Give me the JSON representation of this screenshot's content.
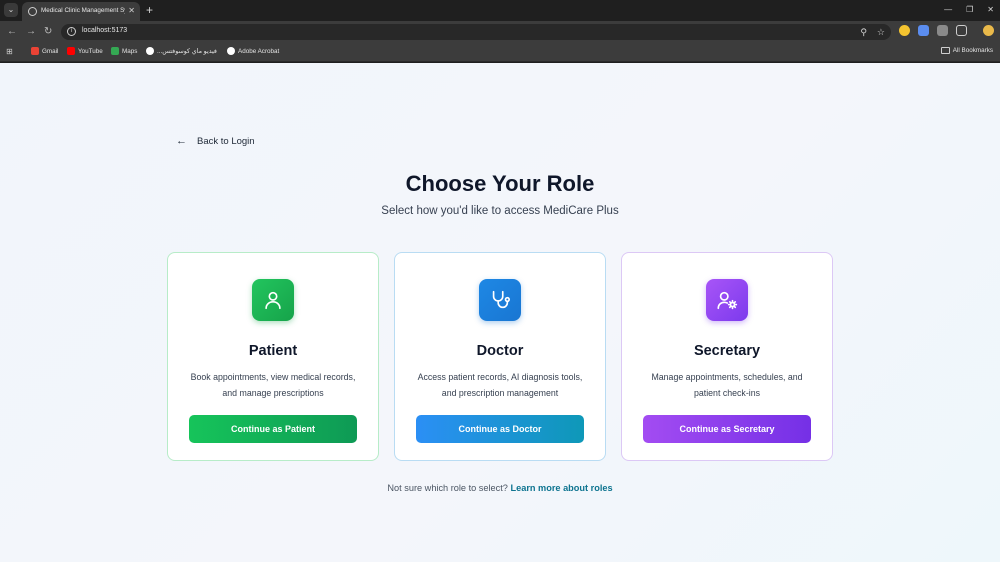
{
  "browser": {
    "tab_title": "Medical Clinic Management Sys",
    "url": "localhost:5173",
    "bookmarks": [
      {
        "label": "Gmail",
        "color": "#ea4335"
      },
      {
        "label": "YouTube",
        "color": "#ff0000"
      },
      {
        "label": "Maps",
        "color": "#34a853"
      },
      {
        "label": "...فيديو ماي كوسوفتس",
        "color": "#ffffff"
      },
      {
        "label": "Adobe Acrobat",
        "color": "#ffffff"
      }
    ],
    "all_bookmarks": "All Bookmarks"
  },
  "page": {
    "back_label": "Back to Login",
    "title": "Choose Your Role",
    "subtitle": "Select how you'd like to access MediCare Plus",
    "roles": [
      {
        "name": "Patient",
        "icon": "user-icon",
        "description": "Book appointments, view medical records, and manage prescriptions",
        "button": "Continue as Patient",
        "accent": "#16a34a"
      },
      {
        "name": "Doctor",
        "icon": "stethoscope-icon",
        "description": "Access patient records, AI diagnosis tools, and prescription management",
        "button": "Continue as Doctor",
        "accent": "#1976d2"
      },
      {
        "name": "Secretary",
        "icon": "user-cog-icon",
        "description": "Manage appointments, schedules, and patient check-ins",
        "button": "Continue as Secretary",
        "accent": "#7c3aed"
      }
    ],
    "help_text": "Not sure which role to select?",
    "help_link": "Learn more about roles"
  }
}
